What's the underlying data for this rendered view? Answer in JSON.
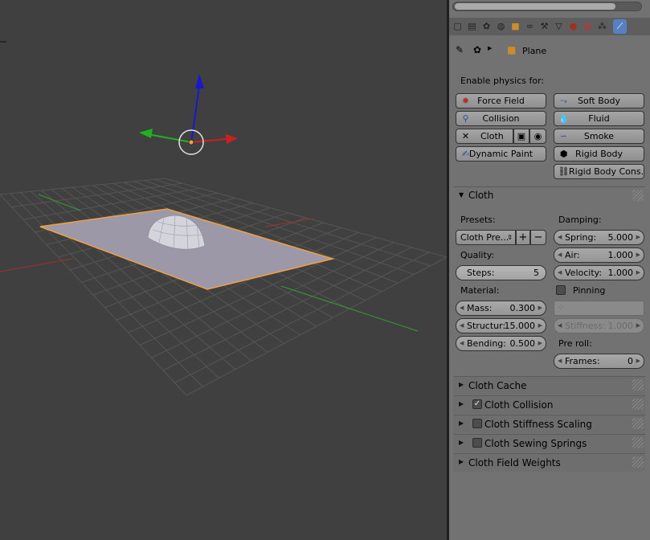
{
  "header": {
    "breadcrumb_object": "Plane",
    "tabs": [
      "render-icon",
      "render-layers-icon",
      "scene-icon",
      "world-icon",
      "object-icon",
      "constraints-icon",
      "modifiers-icon",
      "data-icon",
      "material-icon",
      "texture-icon",
      "particles-icon",
      "physics-icon"
    ],
    "active_tab": "physics-icon"
  },
  "enable_physics": {
    "label": "Enable physics for:",
    "force_field": "Force Field",
    "soft_body": "Soft Body",
    "collision": "Collision",
    "fluid": "Fluid",
    "cloth": "Cloth",
    "smoke": "Smoke",
    "dynamic_paint": "Dynamic Paint",
    "rigid_body": "Rigid Body",
    "rigid_body_constraint": "Rigid Body Cons..."
  },
  "cloth": {
    "title": "Cloth",
    "presets_label": "Presets:",
    "preset_value": "Cloth Pre...",
    "damping_label": "Damping:",
    "spring_label": "Spring:",
    "spring_value": "5.000",
    "air_label": "Air:",
    "air_value": "1.000",
    "velocity_label": "Velocity:",
    "velocity_value": "1.000",
    "quality_label": "Quality:",
    "steps_label": "Steps:",
    "steps_value": "5",
    "pinning_label": "Pinning",
    "material_label": "Material:",
    "mass_label": "Mass:",
    "mass_value": "0.300",
    "structural_label": "Structur:",
    "structural_value": "15.000",
    "stiffness_label": "Stiffness:",
    "stiffness_value": "1.000",
    "bending_label": "Bending:",
    "bending_value": "0.500",
    "preroll_label": "Pre roll:",
    "frames_label": "Frames:",
    "frames_value": "0"
  },
  "subpanels": [
    {
      "title": "Cloth Cache",
      "checkbox": null
    },
    {
      "title": "Cloth Collision",
      "checkbox": true
    },
    {
      "title": "Cloth Stiffness Scaling",
      "checkbox": false
    },
    {
      "title": "Cloth Sewing Springs",
      "checkbox": false
    },
    {
      "title": "Cloth Field Weights",
      "checkbox": null
    }
  ],
  "colors": {
    "viewport_bg": "#404040",
    "panel_bg": "#727272",
    "selection_outline": "#f0a040",
    "axis_x": "#cc2020",
    "axis_y": "#20b020",
    "axis_z": "#1818d0",
    "active_tab": "#5680c2"
  }
}
